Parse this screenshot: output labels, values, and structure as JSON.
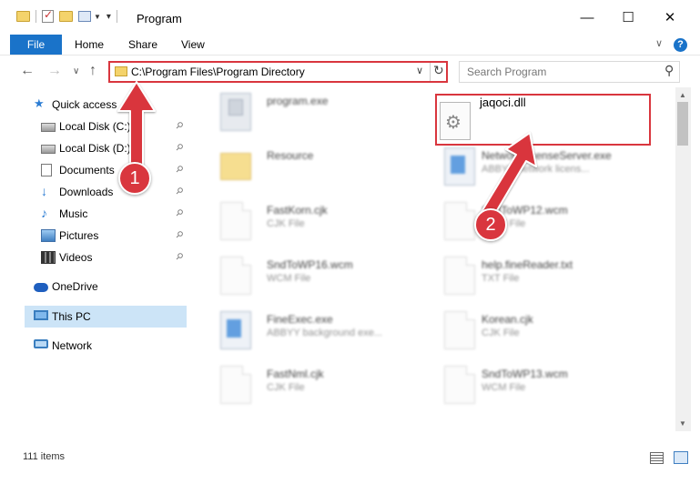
{
  "window": {
    "title": "Program",
    "minimize": "—",
    "maximize": "☐",
    "close": "✕"
  },
  "ribbon": {
    "file": "File",
    "home": "Home",
    "share": "Share",
    "view": "View",
    "expand": "∨",
    "help": "?"
  },
  "nav": {
    "back": "←",
    "forward": "→",
    "recent": "∨",
    "up": "↑"
  },
  "address": {
    "path": "C:\\Program Files\\Program Directory",
    "dropdown": "∨",
    "refresh": "↻"
  },
  "search": {
    "placeholder": "Search Program",
    "icon": "⚲"
  },
  "sidebar": {
    "items": [
      {
        "label": "Quick access",
        "icon": "star-icon",
        "glyph": "★"
      },
      {
        "label": "Local Disk (C:)",
        "icon": "drive-icon",
        "pinned": true
      },
      {
        "label": "Local Disk (D:)",
        "icon": "drive-icon",
        "pinned": true
      },
      {
        "label": "Documents",
        "icon": "documents-icon",
        "pinned": true
      },
      {
        "label": "Downloads",
        "icon": "download-icon",
        "glyph": "↓",
        "pinned": true
      },
      {
        "label": "Music",
        "icon": "music-icon",
        "glyph": "♪",
        "pinned": true
      },
      {
        "label": "Pictures",
        "icon": "pictures-icon",
        "pinned": true
      },
      {
        "label": "Videos",
        "icon": "videos-icon",
        "pinned": true
      },
      {
        "label": "OneDrive",
        "icon": "cloud-icon"
      },
      {
        "label": "This PC",
        "icon": "computer-icon",
        "selected": true
      },
      {
        "label": "Network",
        "icon": "network-icon"
      }
    ],
    "pin_glyph": "⚲"
  },
  "files": [
    {
      "name": "program.exe",
      "type": ""
    },
    {
      "name": "jaqoci.dll",
      "type": ""
    },
    {
      "name": "Resource",
      "type": ""
    },
    {
      "name": "NetworkLicenseServer.exe",
      "type": "ABBYY network licens..."
    },
    {
      "name": "FastKorn.cjk",
      "type": "CJK File"
    },
    {
      "name": "SndToWP12.wcm",
      "type": "WCM File"
    },
    {
      "name": "SndToWP16.wcm",
      "type": "WCM File"
    },
    {
      "name": "help.fineReader.txt",
      "type": "TXT File"
    },
    {
      "name": "FineExec.exe",
      "type": "ABBYY background exe..."
    },
    {
      "name": "Korean.cjk",
      "type": "CJK File"
    },
    {
      "name": "FastNml.cjk",
      "type": "CJK File"
    },
    {
      "name": "SndToWP13.wcm",
      "type": "WCM File"
    }
  ],
  "annotations": {
    "step1": "1",
    "step2": "2",
    "color": "#d9363e"
  },
  "status": {
    "item_count": "111 items"
  },
  "scrollbar": {
    "up": "▲",
    "down": "▼"
  }
}
